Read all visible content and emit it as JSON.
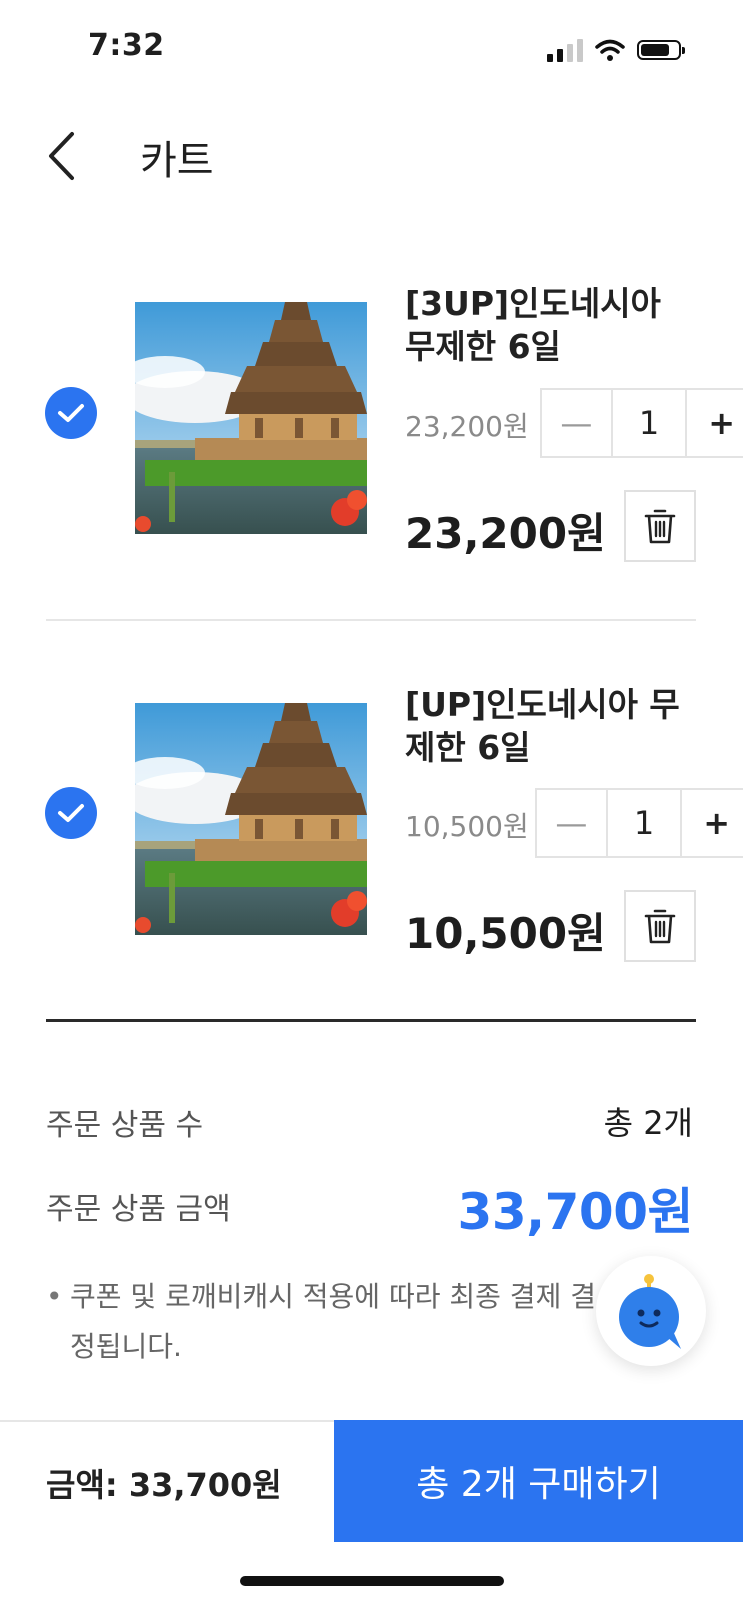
{
  "status_bar": {
    "time": "7:32"
  },
  "header": {
    "title": "카트"
  },
  "items": [
    {
      "name": "[3UP]인도네시아 무제한 6일",
      "unit_price": "23,200원",
      "quantity": "1",
      "line_total": "23,200원",
      "checked": true
    },
    {
      "name": "[UP]인도네시아 무제한 6일",
      "unit_price": "10,500원",
      "quantity": "1",
      "line_total": "10,500원",
      "checked": true
    }
  ],
  "stepper": {
    "minus": "—",
    "plus": "+"
  },
  "summary": {
    "count_label": "주문 상품 수",
    "count_value": "총 2개",
    "amount_label": "주문 상품 금액",
    "amount_value": "33,700원",
    "notice_bullet": "•",
    "notice": "쿠폰 및 로깨비캐시 적용에 따라 최종 결제 결정됩니다."
  },
  "bottom_bar": {
    "amount": "금액: 33,700원",
    "buy_button": "총 2개 구매하기"
  },
  "colors": {
    "accent": "#2b74f0",
    "text": "#1f1f1f",
    "muted": "#8a8a8a"
  },
  "icons": {
    "back": "chevron-left-icon",
    "check": "check-icon",
    "trash": "trash-icon",
    "chatbot": "chatbot-icon"
  }
}
